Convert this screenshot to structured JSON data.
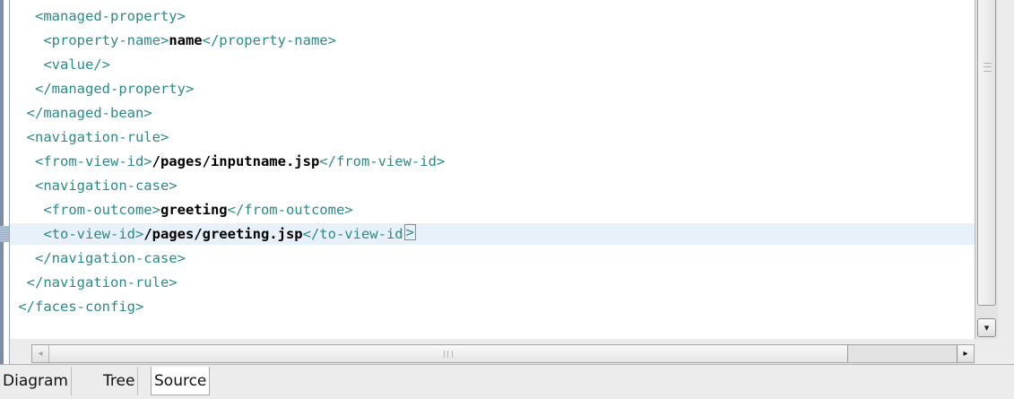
{
  "editor": {
    "lines": [
      [
        {
          "t": "tag",
          "v": "   <managed-property>"
        }
      ],
      [
        {
          "t": "tag",
          "v": "    <property-name>"
        },
        {
          "t": "txt",
          "v": "name"
        },
        {
          "t": "tag",
          "v": "</property-name>"
        }
      ],
      [
        {
          "t": "tag",
          "v": "    <value/>"
        }
      ],
      [
        {
          "t": "tag",
          "v": "   </managed-property>"
        }
      ],
      [
        {
          "t": "tag",
          "v": "  </managed-bean>"
        }
      ],
      [
        {
          "t": "tag",
          "v": "  <navigation-rule>"
        }
      ],
      [
        {
          "t": "tag",
          "v": "   <from-view-id>"
        },
        {
          "t": "txt",
          "v": "/pages/inputname.jsp"
        },
        {
          "t": "tag",
          "v": "</from-view-id>"
        }
      ],
      [
        {
          "t": "tag",
          "v": "   <navigation-case>"
        }
      ],
      [
        {
          "t": "tag",
          "v": "    <from-outcome>"
        },
        {
          "t": "txt",
          "v": "greeting"
        },
        {
          "t": "tag",
          "v": "</from-outcome>"
        }
      ],
      [
        {
          "t": "tag",
          "v": "    <to-view-id>"
        },
        {
          "t": "txt",
          "v": "/pages/greeting.jsp"
        },
        {
          "t": "tag",
          "v": "</to-view-id"
        },
        {
          "t": "caret",
          "v": ">"
        }
      ],
      [
        {
          "t": "tag",
          "v": "   </navigation-case>"
        }
      ],
      [
        {
          "t": "tag",
          "v": "  </navigation-rule>"
        }
      ],
      [
        {
          "t": "tag",
          "v": " </faces-config>"
        }
      ]
    ],
    "current_line_index": 9
  },
  "scrollbars": {
    "down_arrow": "▾",
    "left_arrow": "◂",
    "right_arrow": "▸"
  },
  "tabs": [
    {
      "label": "Diagram",
      "active": false
    },
    {
      "label": "Tree",
      "active": false
    },
    {
      "label": "Source",
      "active": true
    }
  ],
  "colors": {
    "tag": "#2a8a88",
    "text": "#000000",
    "current_line": "#e8f0fa"
  }
}
